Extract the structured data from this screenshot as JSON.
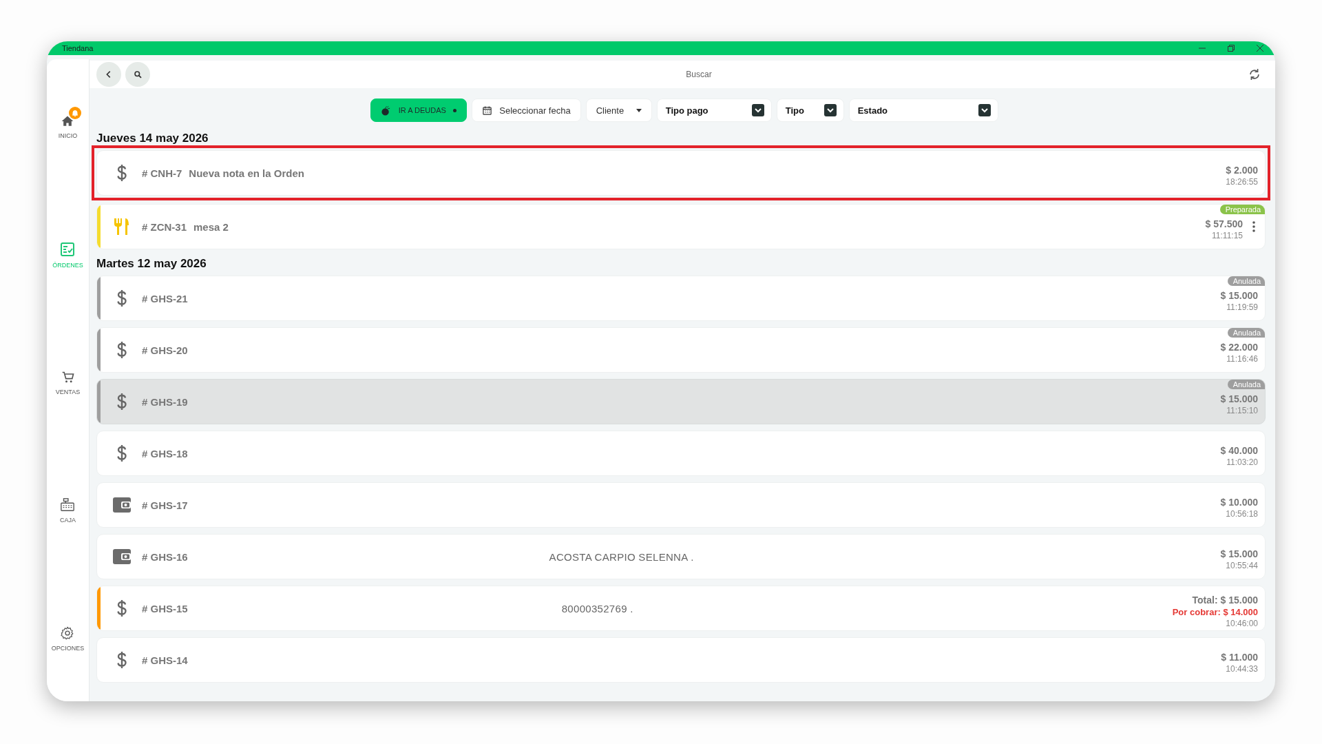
{
  "window": {
    "title": "Tiendana"
  },
  "sidebar": {
    "items": [
      {
        "label": "INICIO",
        "kind": "home",
        "selected": false,
        "notification": true
      },
      {
        "label": "ÓRDENES",
        "kind": "orders",
        "selected": true,
        "notification": false
      },
      {
        "label": "VENTAS",
        "kind": "cart",
        "selected": false,
        "notification": false
      },
      {
        "label": "CAJA",
        "kind": "register",
        "selected": false,
        "notification": false
      },
      {
        "label": "OPCIONES",
        "kind": "settings",
        "selected": false,
        "notification": false
      }
    ]
  },
  "topbar": {
    "title": "Buscar"
  },
  "filters": [
    {
      "kind": "action",
      "label": "IR A DEUDAS"
    },
    {
      "kind": "date",
      "label": "Seleccionar fecha"
    },
    {
      "kind": "dropdown",
      "label": "Cliente"
    },
    {
      "kind": "select",
      "label": "Tipo pago"
    },
    {
      "kind": "select",
      "label": "Tipo"
    },
    {
      "kind": "select",
      "label": "Estado"
    }
  ],
  "groups": [
    {
      "date": "Jueves 14 may 2026",
      "orders": [
        {
          "kind": "dollar",
          "code": "# CNH-7",
          "note": "Nueva nota en la Orden",
          "amount": "$ 2.000",
          "time": "18:26:55",
          "highlighted": true,
          "shaded": false,
          "menu": false
        },
        {
          "kind": "cutlery",
          "code": "# ZCN-31",
          "note": "mesa 2",
          "amount": "$ 57.500",
          "time": "11:11:15",
          "color": "#f5dc2f",
          "badge": {
            "label": "Preparada",
            "color": "#8bc34a"
          },
          "highlighted": false,
          "shaded": false,
          "menu": true
        }
      ]
    },
    {
      "date": "Martes 12 may 2026",
      "orders": [
        {
          "kind": "dollar",
          "code": "# GHS-21",
          "amount": "$ 15.000",
          "time": "11:19:59",
          "color": "#9e9e9e",
          "badge": {
            "label": "Anulada",
            "color": "#9e9e9e"
          },
          "highlighted": false,
          "shaded": false,
          "menu": false
        },
        {
          "kind": "dollar",
          "code": "# GHS-20",
          "amount": "$ 22.000",
          "time": "11:16:46",
          "color": "#9e9e9e",
          "badge": {
            "label": "Anulada",
            "color": "#9e9e9e"
          },
          "highlighted": false,
          "shaded": false,
          "menu": false
        },
        {
          "kind": "dollar",
          "code": "# GHS-19",
          "amount": "$ 15.000",
          "time": "11:15:10",
          "color": "#9e9e9e",
          "badge": {
            "label": "Anulada",
            "color": "#9e9e9e"
          },
          "highlighted": false,
          "shaded": true,
          "menu": false
        },
        {
          "kind": "dollar",
          "code": "# GHS-18",
          "amount": "$ 40.000",
          "time": "11:03:20",
          "highlighted": false,
          "shaded": false,
          "menu": false
        },
        {
          "kind": "wallet",
          "code": "# GHS-17",
          "amount": "$ 10.000",
          "time": "10:56:18",
          "highlighted": false,
          "shaded": false,
          "menu": false
        },
        {
          "kind": "wallet",
          "code": "# GHS-16",
          "client": "ACOSTA CARPIO SELENNA .",
          "amount": "$ 15.000",
          "time": "10:55:44",
          "highlighted": false,
          "shaded": false,
          "menu": false
        },
        {
          "kind": "dollar",
          "code": "# GHS-15",
          "client": "80000352769 .",
          "total": "Total: $ 15.000",
          "due": "Por cobrar: $ 14.000",
          "time": "10:46:00",
          "color": "#ff9800",
          "highlighted": false,
          "shaded": false,
          "menu": false
        },
        {
          "kind": "dollar",
          "code": "# GHS-14",
          "amount": "$ 11.000",
          "time": "10:44:33",
          "highlighted": false,
          "shaded": false,
          "menu": false
        }
      ]
    }
  ]
}
